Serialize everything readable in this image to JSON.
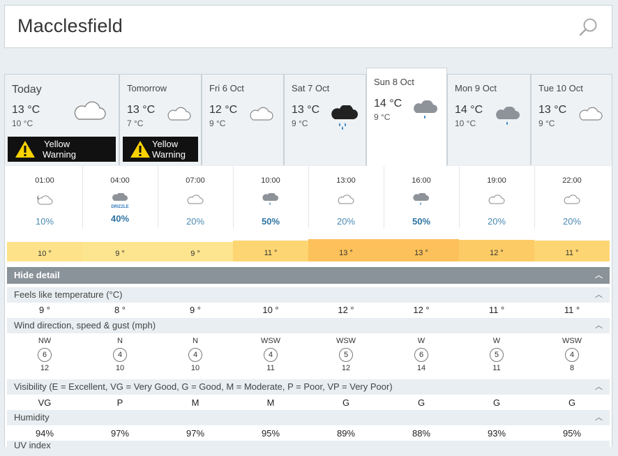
{
  "search": {
    "value": "Macclesfield"
  },
  "days": [
    {
      "name": "Today",
      "hi": "13 °C",
      "lo": "10 °C",
      "icon": "cloud-icon",
      "warning": "Yellow Warning"
    },
    {
      "name": "Tomorrow",
      "hi": "13 °C",
      "lo": "7 °C",
      "icon": "cloud-icon",
      "warning": "Yellow Warning"
    },
    {
      "name": "Fri 6 Oct",
      "hi": "12 °C",
      "lo": "9 °C",
      "icon": "cloud-icon"
    },
    {
      "name": "Sat 7 Oct",
      "hi": "13 °C",
      "lo": "9 °C",
      "icon": "heavy-rain-icon"
    },
    {
      "name": "Sun 8 Oct",
      "hi": "14 °C",
      "lo": "9 °C",
      "icon": "light-rain-icon"
    },
    {
      "name": "Mon 9 Oct",
      "hi": "14 °C",
      "lo": "10 °C",
      "icon": "light-rain-icon"
    },
    {
      "name": "Tue 10 Oct",
      "hi": "13 °C",
      "lo": "9 °C",
      "icon": "cloud-icon"
    }
  ],
  "warning_line1": "Yellow",
  "warning_line2": "Warning",
  "hours": [
    {
      "time": "01:00",
      "icon": "partly-cloudy-night-icon",
      "pct": "10%",
      "bold": false,
      "temp": "10 °",
      "color": "#fde28a"
    },
    {
      "time": "04:00",
      "icon": "drizzle-icon",
      "icon_label": "DRIZZLE",
      "pct": "40%",
      "bold": true,
      "temp": "9 °",
      "color": "#fde48e"
    },
    {
      "time": "07:00",
      "icon": "cloud-icon",
      "pct": "20%",
      "bold": false,
      "temp": "9 °",
      "color": "#fde48e"
    },
    {
      "time": "10:00",
      "icon": "light-rain-icon",
      "pct": "50%",
      "bold": true,
      "temp": "11 °",
      "color": "#fdd572"
    },
    {
      "time": "13:00",
      "icon": "cloud-icon",
      "pct": "20%",
      "bold": false,
      "temp": "13 °",
      "color": "#fcc15a"
    },
    {
      "time": "16:00",
      "icon": "light-rain-icon",
      "pct": "50%",
      "bold": true,
      "temp": "13 °",
      "color": "#fcc15a"
    },
    {
      "time": "19:00",
      "icon": "cloud-icon",
      "pct": "20%",
      "bold": false,
      "temp": "12 °",
      "color": "#fdcb66"
    },
    {
      "time": "22:00",
      "icon": "cloud-icon",
      "pct": "20%",
      "bold": false,
      "temp": "11 °",
      "color": "#fdd572"
    }
  ],
  "hide_detail": "Hide detail",
  "sections": {
    "feels": "Feels like temperature (°C)",
    "wind": "Wind direction, speed & gust (mph)",
    "visibility": "Visibility (E = Excellent, VG = Very Good, G = Good, M = Moderate, P = Poor, VP = Very Poor)",
    "humidity": "Humidity",
    "uv": "UV index"
  },
  "feels": [
    "9 °",
    "8 °",
    "9 °",
    "10 °",
    "12 °",
    "12 °",
    "11 °",
    "11 °"
  ],
  "wind": [
    {
      "dir": "NW",
      "speed": "6",
      "gust": "12"
    },
    {
      "dir": "N",
      "speed": "4",
      "gust": "10"
    },
    {
      "dir": "N",
      "speed": "4",
      "gust": "10"
    },
    {
      "dir": "WSW",
      "speed": "4",
      "gust": "11"
    },
    {
      "dir": "WSW",
      "speed": "5",
      "gust": "12"
    },
    {
      "dir": "W",
      "speed": "6",
      "gust": "14"
    },
    {
      "dir": "W",
      "speed": "5",
      "gust": "11"
    },
    {
      "dir": "WSW",
      "speed": "4",
      "gust": "8"
    }
  ],
  "visibility": [
    "VG",
    "P",
    "M",
    "M",
    "G",
    "G",
    "G",
    "G"
  ],
  "humidity": [
    "94%",
    "97%",
    "97%",
    "95%",
    "89%",
    "88%",
    "93%",
    "95%"
  ]
}
